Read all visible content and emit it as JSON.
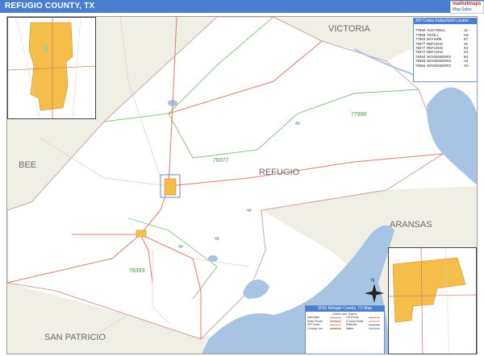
{
  "header": {
    "title": "REFUGIO COUNTY, TX"
  },
  "logo": {
    "word": "marketmaps",
    "sub": "Map Sales"
  },
  "map": {
    "county_name": "REFUGIO",
    "neighbors": [
      "VICTORIA",
      "BEE",
      "ARANSAS",
      "SAN PATRICIO"
    ],
    "zip_labels": [
      "77990",
      "78377",
      "78393"
    ],
    "colors": {
      "land": "#ffffff",
      "water": "#a8c4e4",
      "neighbor": "#efefe6",
      "city": "#f5be4a",
      "highway": "#e07a6a",
      "zip_boundary": "#7cc47c",
      "county_boundary": "#d8a0a0",
      "road": "#e8c8c8"
    },
    "compass": "N"
  },
  "zip_legend": {
    "title": "ZIP Codes Index/Grid Locator",
    "rows": [
      {
        "zip": "",
        "name": "",
        "grid": ""
      },
      {
        "zip": "77950",
        "name": "AUSTWELL",
        "grid": "J2"
      },
      {
        "zip": "77960",
        "name": "TIVOLI",
        "grid": "H3"
      },
      {
        "zip": "77963",
        "name": "BAYSIDE",
        "grid": "E7"
      },
      {
        "zip": "78377",
        "name": "REFUGIO",
        "grid": "J6"
      },
      {
        "zip": "78377",
        "name": "REFUGIO",
        "grid": "K2"
      },
      {
        "zip": "78377",
        "name": "REFUGIO",
        "grid": "K3"
      },
      {
        "zip": "78393",
        "name": "WOODSBORO",
        "grid": "B4"
      },
      {
        "zip": "78393",
        "name": "WOODSBORO",
        "grid": "A2"
      },
      {
        "zip": "78393",
        "name": "WOODSBORO",
        "grid": "C6"
      }
    ]
  },
  "map_key": {
    "title": "2016 Refugio County, TX Map",
    "subtitle": "Cities and Towns",
    "items": [
      {
        "label": "Interstate",
        "color": "#e07a6a"
      },
      {
        "label": "US Route",
        "color": "#e07a6a"
      },
      {
        "label": "State Route",
        "color": "#e8a0a0"
      },
      {
        "label": "County Road",
        "color": "#e8c8c8"
      },
      {
        "label": "ZIP Code",
        "color": "#7cc47c"
      },
      {
        "label": "Railroad",
        "color": "#777777"
      },
      {
        "label": "County Line",
        "color": "#d8a0a0"
      },
      {
        "label": "Water",
        "color": "#a8c4e4"
      }
    ]
  }
}
